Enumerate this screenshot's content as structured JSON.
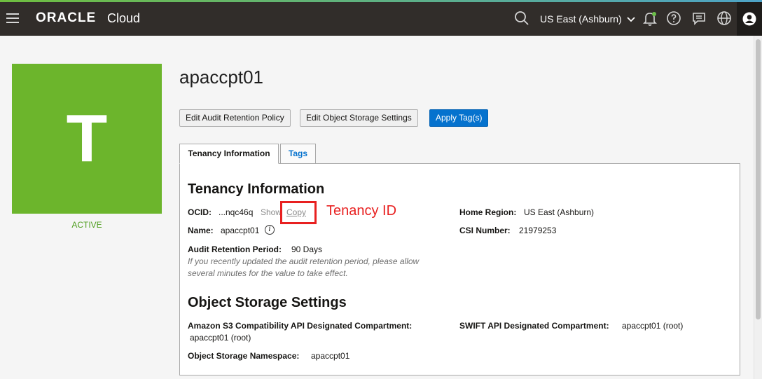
{
  "header": {
    "logo_brand": "ORACLE",
    "logo_product": "Cloud",
    "region": "US East (Ashburn)",
    "accent_gradient": [
      "#6fbe3f",
      "#4da3c7"
    ],
    "icons": [
      "menu-icon",
      "search-icon",
      "chevron-down-icon",
      "bell-icon",
      "help-icon",
      "chat-icon",
      "globe-icon",
      "user-icon"
    ]
  },
  "tenancy": {
    "initial": "T",
    "tile_color": "#6cb52c",
    "status": "ACTIVE",
    "name": "apaccpt01"
  },
  "actions": {
    "edit_audit": "Edit Audit Retention Policy",
    "edit_storage": "Edit Object Storage Settings",
    "apply_tags": "Apply Tag(s)"
  },
  "tabs": [
    {
      "label": "Tenancy Information",
      "active": true
    },
    {
      "label": "Tags",
      "active": false
    }
  ],
  "info": {
    "heading": "Tenancy Information",
    "ocid_label": "OCID:",
    "ocid_value": "...nqc46q",
    "show_link": "Show",
    "copy_link": "Copy",
    "name_label": "Name:",
    "name_value": "apaccpt01",
    "audit_label": "Audit Retention Period:",
    "audit_value": "90 Days",
    "audit_note_line1": "If you recently updated the audit retention period, please allow",
    "audit_note_line2": "several minutes for the value to take effect.",
    "home_region_label": "Home Region:",
    "home_region_value": "US East (Ashburn)",
    "csi_label": "CSI Number:",
    "csi_value": "21979253"
  },
  "storage": {
    "heading": "Object Storage Settings",
    "s3_label": "Amazon S3 Compatibility API Designated Compartment:",
    "s3_value": "apaccpt01 (root)",
    "swift_label": "SWIFT API Designated Compartment:",
    "swift_value": "apaccpt01 (root)",
    "namespace_label": "Object Storage Namespace:",
    "namespace_value": "apaccpt01"
  },
  "annotation": {
    "text": "Tenancy ID",
    "color": "#e82020"
  }
}
